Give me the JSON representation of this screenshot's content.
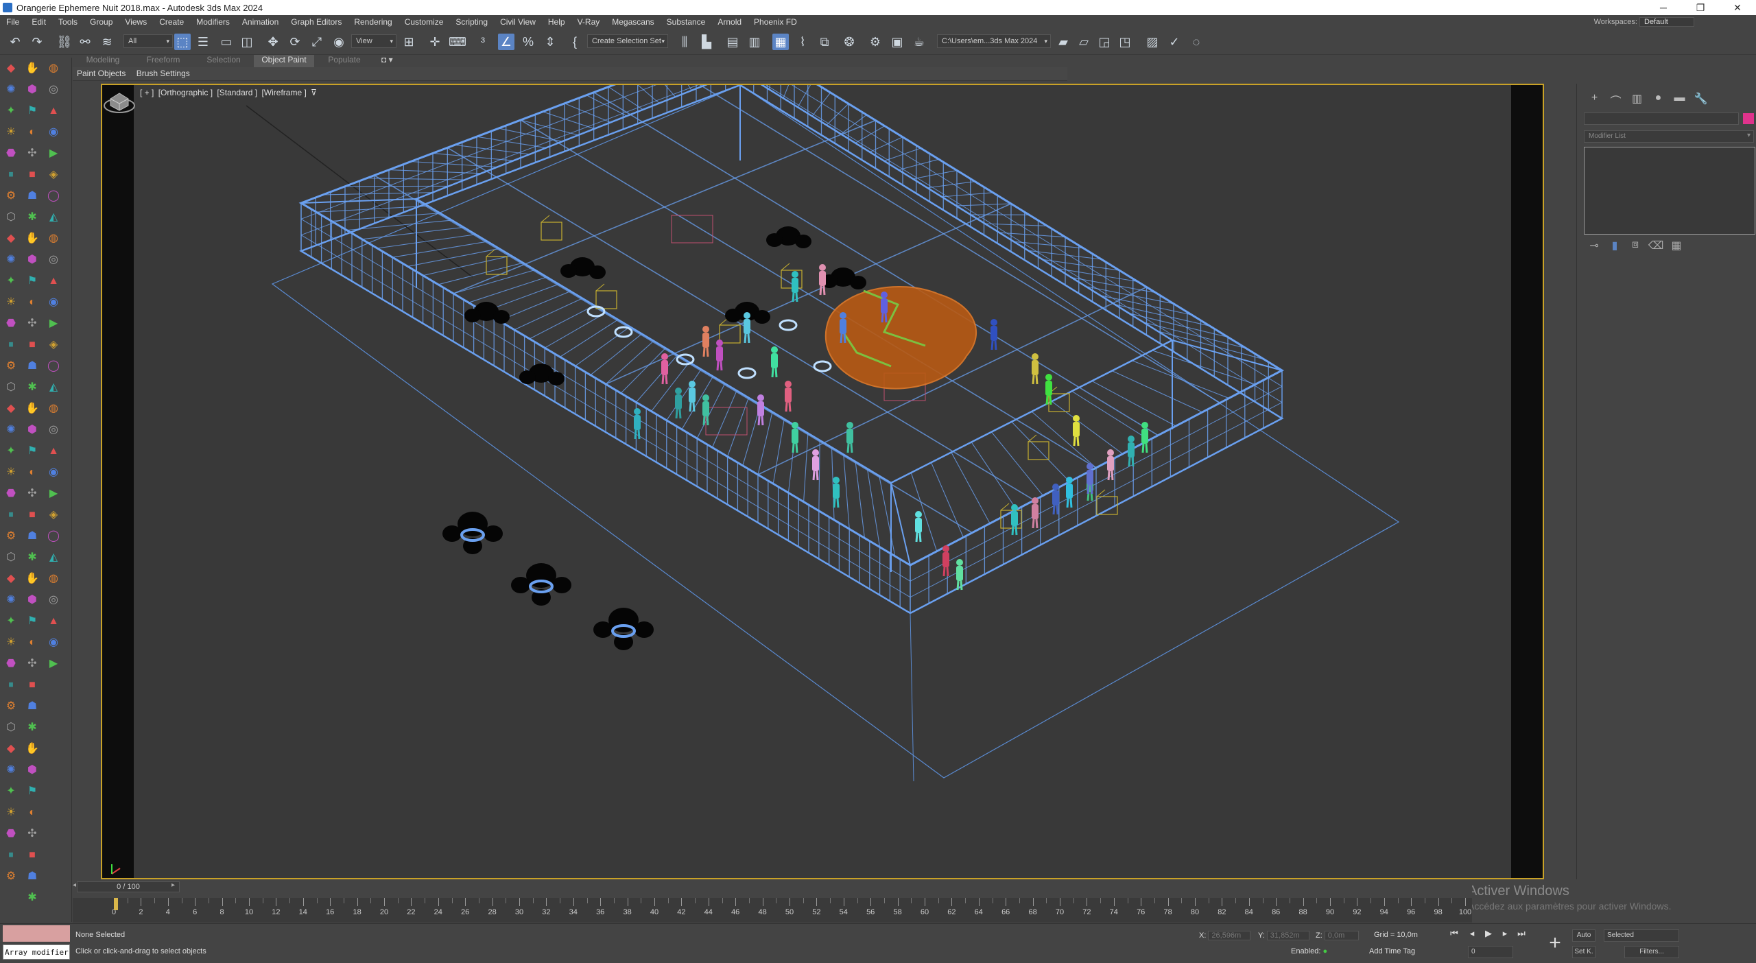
{
  "window": {
    "title": "Orangerie Ephemere Nuit 2018.max - Autodesk 3ds Max 2024",
    "minimize": "─",
    "restore": "❐",
    "close": "✕"
  },
  "menu": {
    "items": [
      "File",
      "Edit",
      "Tools",
      "Group",
      "Views",
      "Create",
      "Modifiers",
      "Animation",
      "Graph Editors",
      "Rendering",
      "Customize",
      "Scripting",
      "Civil View",
      "Help",
      "V-Ray",
      "Megascans",
      "Substance",
      "Arnold",
      "Phoenix FD"
    ],
    "workspaces_label": "Workspaces:",
    "workspace_value": "Default"
  },
  "toolbar": {
    "filter_value": "All",
    "view_value": "View",
    "selection_set_placeholder": "Create Selection Set",
    "path_value": "C:\\Users\\em...3ds Max 2024"
  },
  "ribbon": {
    "tabs": [
      "Modeling",
      "Freeform",
      "Selection",
      "Object Paint",
      "Populate"
    ],
    "active": "Object Paint",
    "pin": "◘ ▾"
  },
  "subtabs": [
    "Paint Objects",
    "Brush Settings"
  ],
  "viewport": {
    "label_plus": "[ + ]",
    "label_view": "[Orthographic ]",
    "label_shading": "[Standard ]",
    "label_render": "[Wireframe ]",
    "label_filter": "⊽"
  },
  "activate": {
    "title": "Activer Windows",
    "subtitle": "Accédez aux paramètres pour activer Windows."
  },
  "command_panel": {
    "tabs": [
      "+",
      "⌒",
      "▥",
      "●",
      "▬",
      "🔧"
    ],
    "modifier_list": "Modifier List"
  },
  "time": {
    "slider": "0 / 100",
    "ticks": [
      0,
      2,
      4,
      6,
      8,
      10,
      12,
      14,
      16,
      18,
      20,
      22,
      24,
      26,
      28,
      30,
      32,
      34,
      36,
      38,
      40,
      42,
      44,
      46,
      48,
      50,
      52,
      54,
      56,
      58,
      60,
      62,
      64,
      66,
      68,
      70,
      72,
      74,
      76,
      78,
      80,
      82,
      84,
      86,
      88,
      90,
      92,
      94,
      96,
      98,
      100
    ],
    "current_frame": 0,
    "frame_field": "0"
  },
  "status": {
    "maxscript_label": "Array modifier",
    "selection": "None Selected",
    "prompt": "Click or click-and-drag to select objects",
    "x_label": "X:",
    "x_value": "26,596m",
    "y_label": "Y:",
    "y_value": "31,852m",
    "z_label": "Z:",
    "z_value": "0,0m",
    "grid": "Grid = 10,0m",
    "enabled": "Enabled:",
    "add_time_tag": "Add Time Tag",
    "auto": "Auto",
    "set_key": "Set K.",
    "selected": "Selected",
    "filters": "Filters..."
  },
  "colors": {
    "accent": "#5b84c4",
    "viewport_border": "#c9a227",
    "wire": "#6aa0f0",
    "object_color": "#e0338c"
  }
}
